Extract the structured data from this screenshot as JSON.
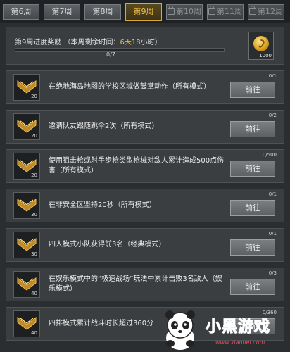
{
  "tabs": [
    {
      "label": "第6周",
      "locked": false,
      "active": false
    },
    {
      "label": "第7周",
      "locked": false,
      "active": false
    },
    {
      "label": "第8周",
      "locked": false,
      "active": false
    },
    {
      "label": "第9周",
      "locked": false,
      "active": true
    },
    {
      "label": "第10周",
      "locked": true,
      "active": false
    },
    {
      "label": "第11周",
      "locked": true,
      "active": false
    },
    {
      "label": "第12周",
      "locked": true,
      "active": false
    }
  ],
  "header": {
    "title_prefix": "第9周进度奖励  （本周剩余时间：",
    "days": "6天",
    "hours": "18",
    "title_suffix": "小时）",
    "progress_text": "0/7",
    "progress_value": 0,
    "reward_amount": "1000",
    "reward_icon": "coin-icon"
  },
  "tasks": [
    {
      "text": "在绝地海岛地图的学校区域做鼓掌动作（所有模式）",
      "count": "0/1",
      "points": "20",
      "button": "前往"
    },
    {
      "text": "邀请队友跟随跳伞2次（所有模式）",
      "count": "0/2",
      "points": "20",
      "button": "前往"
    },
    {
      "text": "使用狙击枪或射手步枪类型枪械对敌人累计造成500点伤害（所有模式）",
      "count": "0/500",
      "points": "20",
      "button": "前往"
    },
    {
      "text": "在非安全区坚持20秒（所有模式）",
      "count": "0/1",
      "points": "30",
      "button": "前往"
    },
    {
      "text": "四人模式小队获得前3名（经典模式）",
      "count": "0/1",
      "points": "30",
      "button": "前往"
    },
    {
      "text": "在娱乐模式中的“极速战场”玩法中累计击败3名敌人（娱乐模式）",
      "count": "0/3",
      "points": "40",
      "button": "前往"
    },
    {
      "text": "四排模式累计战斗时长超过360分",
      "count": "0/360",
      "points": "40",
      "button": "前往"
    }
  ],
  "watermark": {
    "text": "小黑游戏",
    "url": "www.xiaohei.com"
  },
  "colors": {
    "accent": "#f2c04b",
    "background": "#2b2e30",
    "panel": "#3b3e41",
    "button": "#6d7174"
  }
}
